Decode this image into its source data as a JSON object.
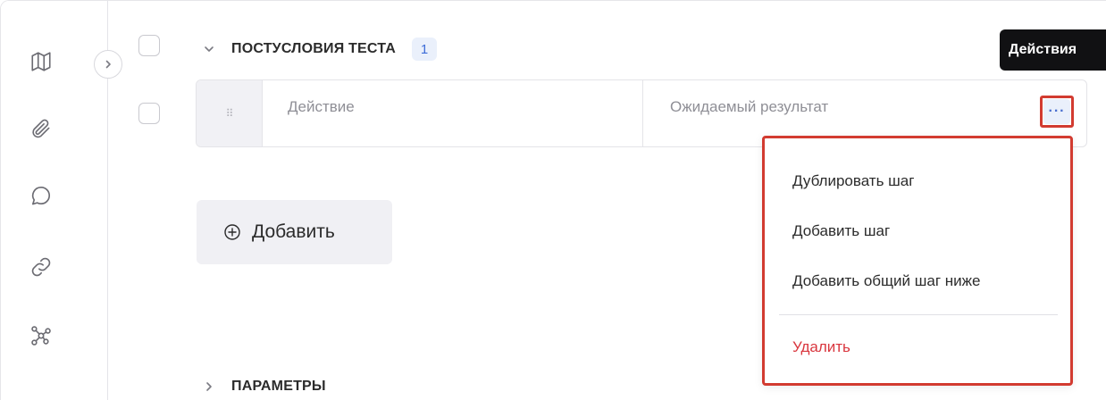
{
  "rail": {
    "icons": [
      "map-icon",
      "paperclip-icon",
      "comment-icon",
      "link-icon",
      "graph-icon"
    ]
  },
  "section": {
    "title": "ПОСТУСЛОВИЯ ТЕСТА",
    "count": "1",
    "expanded": true
  },
  "step": {
    "action_placeholder": "Действие",
    "result_placeholder": "Ожидаемый результат",
    "more_label": "···"
  },
  "tooltip": {
    "text": "Действия"
  },
  "add_button": {
    "label": "Добавить"
  },
  "params": {
    "title": "ПАРАМЕТРЫ",
    "expanded": false
  },
  "menu": {
    "items": [
      {
        "label": "Дублировать шаг",
        "danger": false
      },
      {
        "label": "Добавить шаг",
        "danger": false
      },
      {
        "label": "Добавить общий шаг ниже",
        "danger": false
      },
      {
        "label": "Удалить",
        "danger": true
      }
    ]
  },
  "colors": {
    "accent": "#3e6dd8",
    "badge_bg": "#eaf0fb",
    "danger": "#d9363e",
    "highlight_border": "#d23b30"
  }
}
